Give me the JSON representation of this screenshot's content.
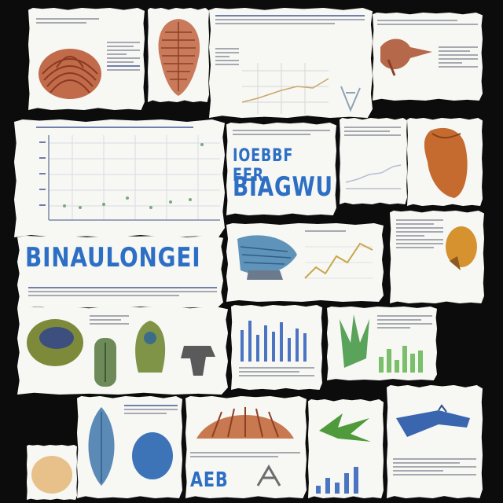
{
  "collage": {
    "headline_left": "BINAULONGEI",
    "headline_top": "IOEBBF FER",
    "headline_mid": "BIAGWU",
    "headline_bottom": "AEB"
  },
  "colors": {
    "background": "#0c0c0c",
    "card": "#f7f7f4",
    "title_blue": "#2c6fc4",
    "specimen_terracotta": "#b85d3c",
    "specimen_green": "#5e9b56",
    "specimen_blue": "#3d74b8",
    "specimen_orange": "#d1874a"
  },
  "icons": [
    "shell-specimen-icon",
    "coral-specimen-icon",
    "claw-specimen-icon",
    "leaf-specimen-icon",
    "egg-specimen-icon"
  ]
}
